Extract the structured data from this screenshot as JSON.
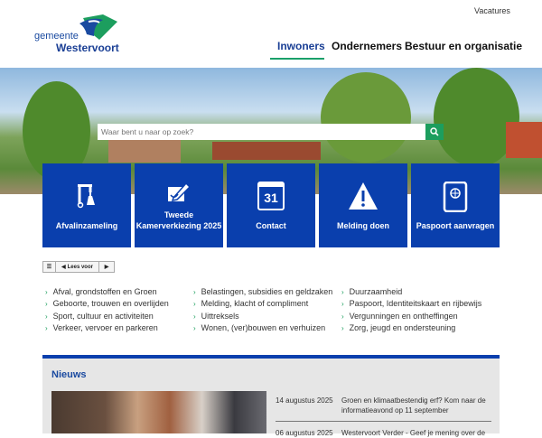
{
  "header": {
    "top_link": "Vacatures",
    "logo_line1": "gemeente",
    "logo_line2": "Westervoort",
    "nav": [
      {
        "label": "Inwoners",
        "active": true
      },
      {
        "label": "Ondernemers"
      },
      {
        "label": "Bestuur en organisatie"
      }
    ]
  },
  "search": {
    "placeholder": "Waar bent u naar op zoek?",
    "icon": "search-icon"
  },
  "tiles": [
    {
      "label": "Afvalinzameling",
      "icon": "waste-bin-icon"
    },
    {
      "label": "Tweede Kamerverkiezing 2025",
      "icon": "ballot-pencil-icon"
    },
    {
      "label": "Contact",
      "icon": "calendar-icon",
      "icon_text": "31"
    },
    {
      "label": "Melding doen",
      "icon": "warning-icon"
    },
    {
      "label": "Paspoort aanvragen",
      "icon": "passport-icon"
    }
  ],
  "readspeaker": {
    "label": "Lees voor"
  },
  "links": [
    [
      "Afval, grondstoffen en Groen",
      "Geboorte, trouwen en overlijden",
      "Sport, cultuur en activiteiten",
      "Verkeer, vervoer en parkeren"
    ],
    [
      "Belastingen, subsidies en geldzaken",
      "Melding, klacht of compliment",
      "Uittreksels",
      "Wonen, (ver)bouwen en verhuizen"
    ],
    [
      "Duurzaamheid",
      "Paspoort, Identiteitskaart en rijbewijs",
      "Vergunningen en ontheffingen",
      "Zorg, jeugd en ondersteuning"
    ]
  ],
  "news": {
    "title": "Nieuws",
    "items": [
      {
        "date": "14 augustus 2025",
        "title": "Groen en klimaatbestendig erf? Kom naar de informatieavond op 11 september"
      },
      {
        "date": "06 augustus 2025",
        "title": "Westervoort Verder - Geef je mening over de"
      }
    ]
  },
  "colors": {
    "brand_blue": "#0a3fad",
    "accent_green": "#1c9e5e"
  }
}
